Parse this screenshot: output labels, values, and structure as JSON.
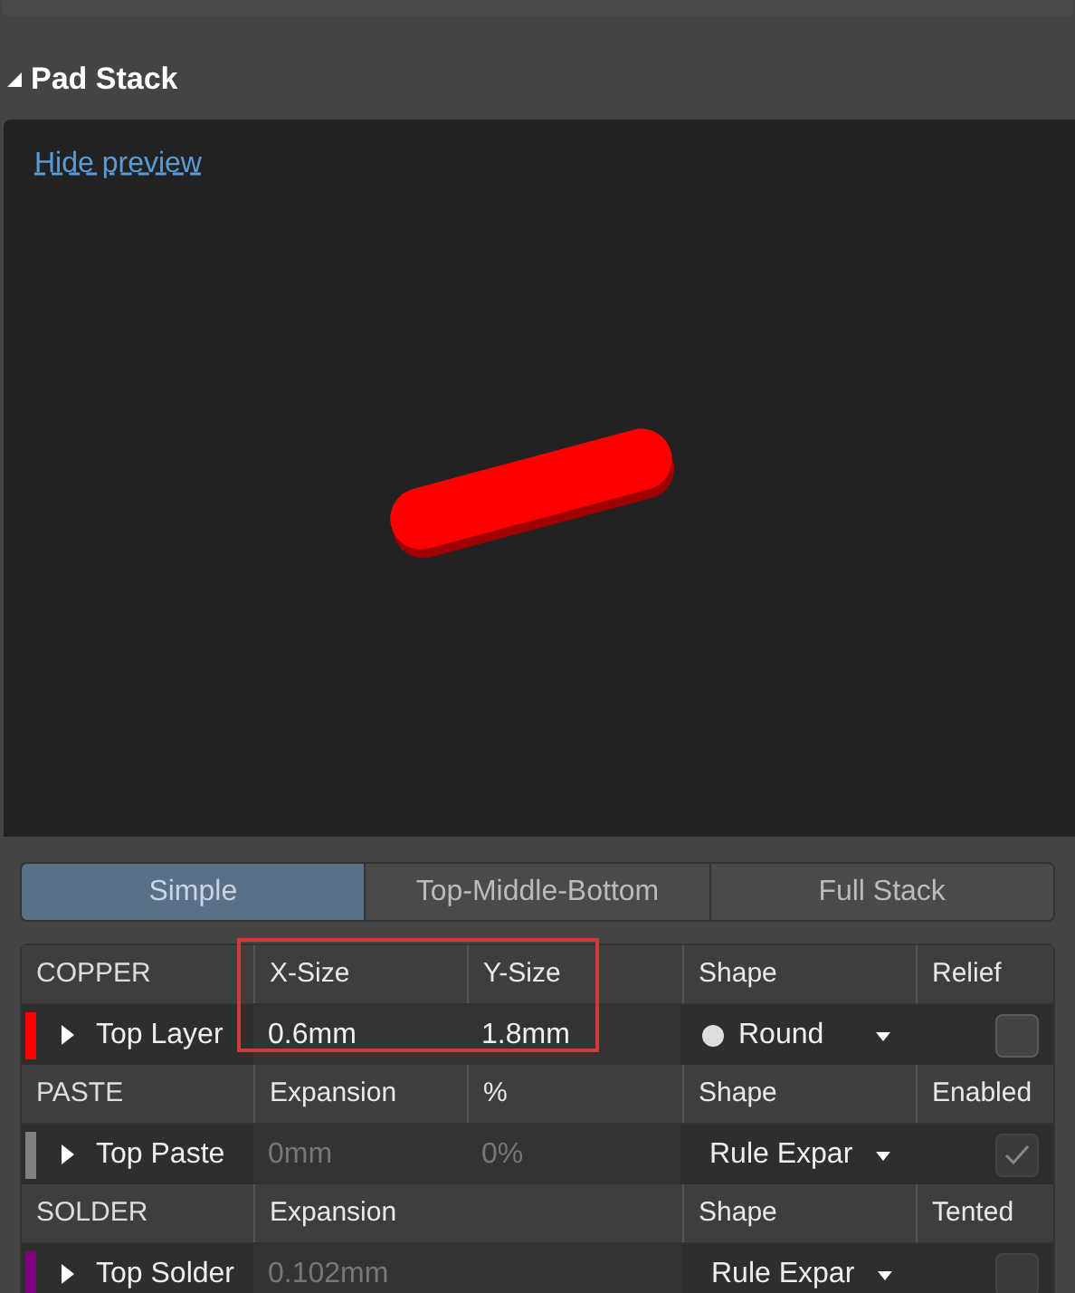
{
  "section": {
    "title": "Pad Stack",
    "expanded": true
  },
  "preview": {
    "link": "Hide preview"
  },
  "tabs": [
    {
      "label": "Simple",
      "selected": true
    },
    {
      "label": "Top-Middle-Bottom",
      "selected": false
    },
    {
      "label": "Full Stack",
      "selected": false
    }
  ],
  "groups": [
    {
      "headers": [
        "COPPER",
        "X-Size",
        "Y-Size",
        "Shape",
        "Relief"
      ],
      "highlighted": true,
      "row": {
        "layer": "Top Layer",
        "color": "#ff0000",
        "values": [
          "0.6mm",
          "1.8mm"
        ],
        "values_disabled": false,
        "shape": "Round",
        "shape_dot": true,
        "checked": false,
        "check_disabled": false
      }
    },
    {
      "headers": [
        "PASTE",
        "Expansion",
        "%",
        "Shape",
        "Enabled"
      ],
      "highlighted": false,
      "row": {
        "layer": "Top Paste",
        "color": "#808080",
        "values": [
          "0mm",
          "0%"
        ],
        "values_disabled": true,
        "shape": "Rule Expar",
        "shape_dot": false,
        "checked": true,
        "check_disabled": true
      }
    },
    {
      "headers": [
        "SOLDER",
        "Expansion",
        "Shape",
        "Tented"
      ],
      "highlighted": false,
      "row": {
        "layer": "Top Solder",
        "color": "#800080",
        "values": [
          "0.102mm"
        ],
        "values_disabled": true,
        "shape": "Rule Expar",
        "shape_dot": false,
        "checked": false,
        "check_disabled": true
      }
    }
  ]
}
